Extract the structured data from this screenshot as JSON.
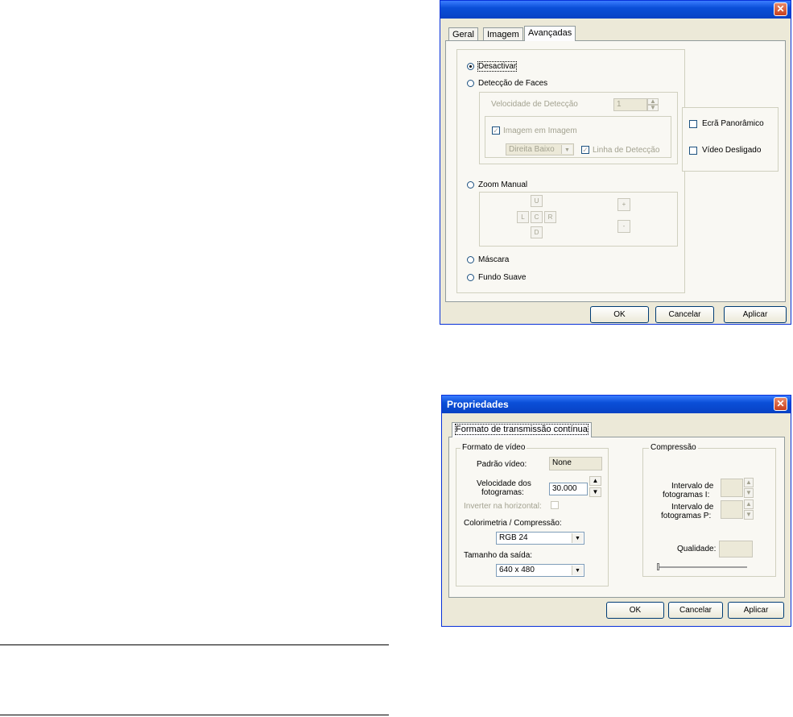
{
  "dialog1": {
    "title": "",
    "close": "✕",
    "tabs": [
      "Geral",
      "Imagem",
      "Avançadas"
    ],
    "options": {
      "desactivar": "Desactivar",
      "deteccao_faces": "Detecção de Faces",
      "velocidade_label": "Velocidade de Detecção",
      "velocidade_value": "1",
      "imagem_em_imagem": "Imagem em Imagem",
      "posicao_value": "Direita Baixo",
      "linha_deteccao": "Linha de Detecção",
      "zoom_manual": "Zoom Manual",
      "zoom_u": "U",
      "zoom_l": "L",
      "zoom_c": "C",
      "zoom_r": "R",
      "zoom_d": "D",
      "zoom_plus": "+",
      "zoom_minus": "-",
      "mascara": "Máscara",
      "fundo_suave": "Fundo Suave",
      "ecra_panoramico": "Ecrã Panorâmico",
      "video_desligado": "Vídeo Desligado"
    },
    "buttons": {
      "ok": "OK",
      "cancelar": "Cancelar",
      "aplicar": "Aplicar"
    }
  },
  "dialog2": {
    "title": "Propriedades",
    "close": "✕",
    "tab": "Formato de transmissão contínua",
    "video_group": {
      "title": "Formato de vídeo",
      "padrao_label": "Padrão vídeo:",
      "padrao_value": "None",
      "velocidade_label_1": "Velocidade dos",
      "velocidade_label_2": "fotogramas:",
      "velocidade_value": "30.000",
      "inverter_label": "Inverter na horizontal:",
      "colorimetria_label": "Colorimetria / Compressão:",
      "colorimetria_value": "RGB 24",
      "tamanho_label": "Tamanho da saída:",
      "tamanho_value": "640 x 480"
    },
    "compressao_group": {
      "title": "Compressão",
      "intervalo_i_1": "Intervalo de",
      "intervalo_i_2": "fotogramas I:",
      "intervalo_p_1": "Intervalo de",
      "intervalo_p_2": "fotogramas P:",
      "qualidade_label": "Qualidade:"
    },
    "buttons": {
      "ok": "OK",
      "cancelar": "Cancelar",
      "aplicar": "Aplicar"
    }
  },
  "spin_up": "▲",
  "spin_down": "▼",
  "dd_arrow": "▼",
  "check_mark": "✓"
}
